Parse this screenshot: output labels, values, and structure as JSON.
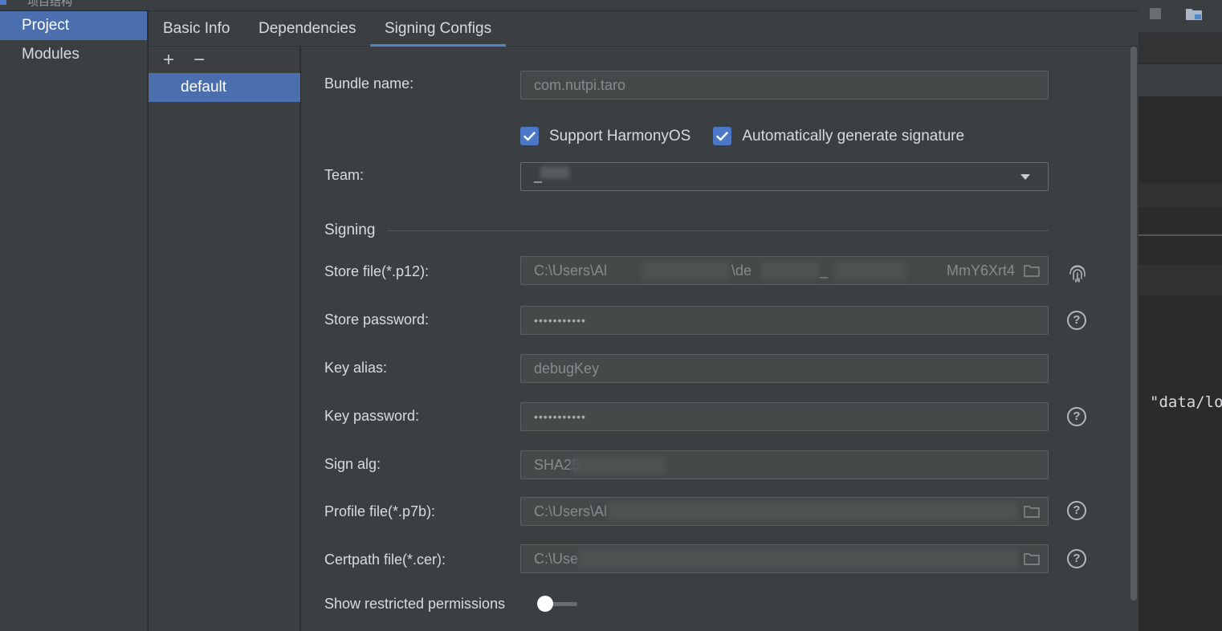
{
  "window": {
    "title_fragment": "项目结构"
  },
  "nav": {
    "items": [
      {
        "label": "Project",
        "selected": true
      },
      {
        "label": "Modules",
        "selected": false
      }
    ]
  },
  "tabs": [
    {
      "label": "Basic Info"
    },
    {
      "label": "Dependencies"
    },
    {
      "label": "Signing Configs",
      "active": true
    }
  ],
  "configs": {
    "add_label": "+",
    "remove_label": "−",
    "items": [
      "default"
    ]
  },
  "form": {
    "bundle_name": {
      "label": "Bundle name:",
      "value": "com.nutpi.taro"
    },
    "support_harmonyos": {
      "label": "Support HarmonyOS",
      "checked": true
    },
    "auto_signature": {
      "label": "Automatically generate signature",
      "checked": true
    },
    "team": {
      "label": "Team:",
      "value": "_"
    },
    "signing_section": "Signing",
    "store_file": {
      "label": "Store file(*.p12):",
      "value_start": "C:\\Users\\Al",
      "value_mid": "\\de",
      "value_mid2": "_",
      "value_end": "MmY6Xrt4"
    },
    "store_password": {
      "label": "Store password:",
      "value": "•••••••••••"
    },
    "key_alias": {
      "label": "Key alias:",
      "value": "debugKey"
    },
    "key_password": {
      "label": "Key password:",
      "value": "•••••••••••"
    },
    "sign_alg": {
      "label": "Sign alg:",
      "value": "SHA25"
    },
    "profile_file": {
      "label": "Profile file(*.p7b):",
      "value": "C:\\Users\\Al"
    },
    "certpath_file": {
      "label": "Certpath file(*.cer):",
      "value": "C:\\Use"
    },
    "show_restricted": {
      "label": "Show restricted permissions",
      "enabled": false
    },
    "help_glyph": "?"
  },
  "editor": {
    "code_fragment": "\"data/lo"
  },
  "colors": {
    "accent": "#4b6eaf",
    "tab_underline": "#4a88c7",
    "checkbox": "#4b78c6",
    "panel": "#3c3f41",
    "field": "#45494a"
  }
}
